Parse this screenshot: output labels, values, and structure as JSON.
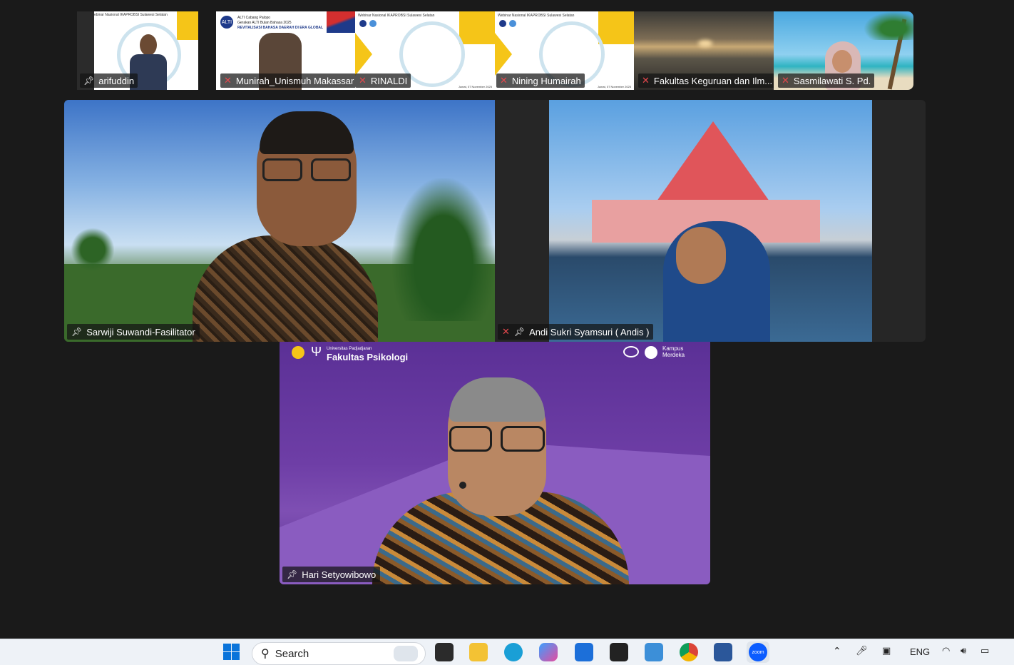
{
  "thumbnails": [
    {
      "name": "arifuddin",
      "muted": false,
      "pinned": true
    },
    {
      "name": "Munirah_Unismuh Makassar",
      "muted": true,
      "pinned": false
    },
    {
      "name": "RINALDI",
      "muted": true,
      "pinned": false
    },
    {
      "name": "Nining Humairah",
      "muted": true,
      "pinned": false
    },
    {
      "name": "Fakultas Keguruan dan Ilm...",
      "muted": true,
      "pinned": false
    },
    {
      "name": "Sasmilawati S. Pd.",
      "muted": true,
      "pinned": false
    }
  ],
  "thumb_slides": {
    "alti_title": "ALTI Cabang Palopo",
    "alti_sub": "Gerakan ALTI Bulan Bahasa 2025",
    "alti_main": "REVITALISASI BAHASA DAERAH DI ERA GLOBAL",
    "webinar_title": "Webinar Nasional IKAPROBSI Sulawesi Selatan",
    "webinar_title_cut": "ebinar Nasional IKAPROBSI Sulawesi Selatan",
    "date": "Jumat, 07 November 2025"
  },
  "main_tiles": {
    "left": {
      "name": "Sarwiji Suwandi-Fasilitator",
      "pinned": true,
      "muted": false
    },
    "right": {
      "name": "Andi Sukri Syamsuri ( Andis )",
      "pinned": true,
      "muted": true
    },
    "bottom": {
      "name": "Hari Setyowibowo",
      "pinned": true,
      "muted": false,
      "banner_university": "Universitas Padjadjaran",
      "banner_faculty": "Fakultas Psikologi",
      "banner_right": "Kampus Merdeka"
    }
  },
  "taskbar": {
    "search_placeholder": "Search",
    "language": "ENG",
    "zoom_icon_label": "zoom"
  },
  "colors": {
    "zoom_bg": "#1a1a1a",
    "muted_red": "#e5484d",
    "purple_bg": "#6b3fa0",
    "taskbar_bg": "#eef2f7"
  }
}
